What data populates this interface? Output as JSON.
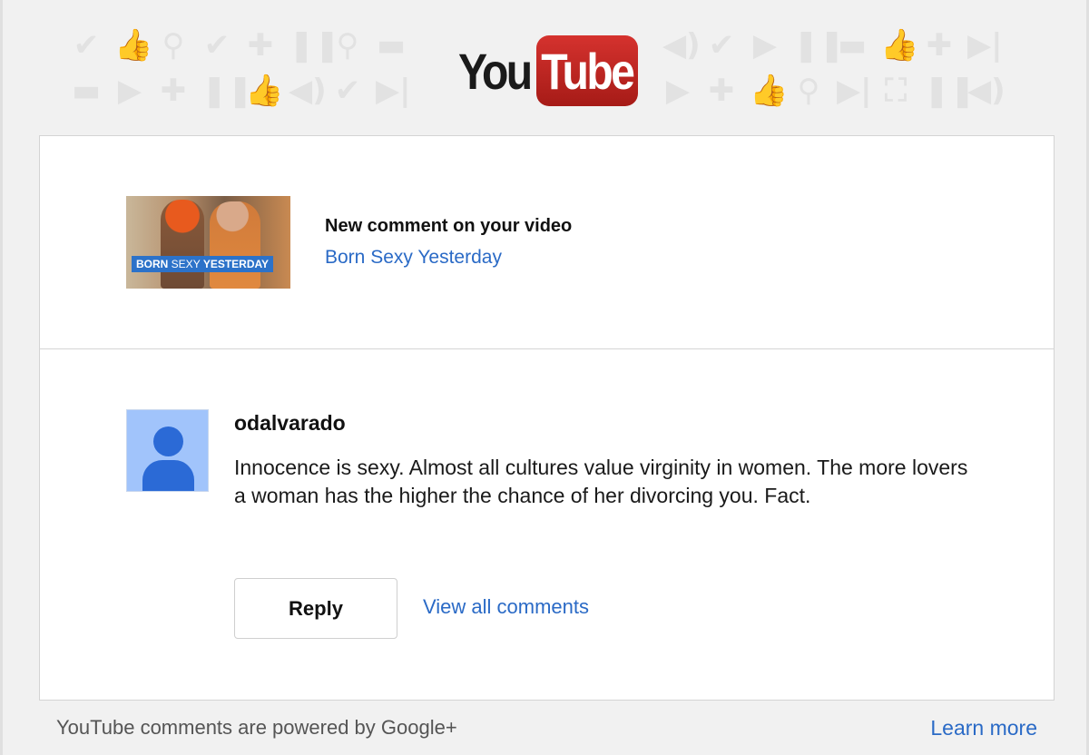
{
  "header": {
    "logo_you": "You",
    "logo_tube": "Tube",
    "pattern_icons_row1_left": [
      "check-icon",
      "thumbs-up-icon",
      "search-icon",
      "check-icon",
      "plus-icon",
      "pause-icon",
      "search-icon",
      "comment-icon"
    ],
    "pattern_icons_row2_left": [
      "comment-icon",
      "play-icon",
      "plus-icon",
      "pause-icon",
      "thumbs-up-icon",
      "volume-icon",
      "check-icon",
      "next-icon"
    ],
    "pattern_icons_row1_right": [
      "volume-icon",
      "check-icon",
      "play-icon",
      "pause-icon",
      "comment-icon",
      "thumbs-up-icon",
      "plus-icon",
      "next-icon"
    ],
    "pattern_icons_row2_right": [
      "play-icon",
      "plus-icon",
      "thumbs-up-icon",
      "search-icon",
      "next-icon",
      "fullscreen-icon",
      "pause-icon",
      "volume-icon"
    ]
  },
  "notification": {
    "thumbnail_caption_bold1": "BORN",
    "thumbnail_caption_light": " SEXY ",
    "thumbnail_caption_bold2": "YESTERDAY",
    "title": "New comment on your video",
    "video_title": "Born Sexy Yesterday"
  },
  "comment": {
    "username": "odalvarado",
    "text": "Innocence is sexy. Almost all cultures value virginity in women. The more lovers a woman has the higher the chance of her divorcing you. Fact.",
    "reply_label": "Reply",
    "view_all_label": "View all comments"
  },
  "footer": {
    "powered_text": "YouTube comments are powered by Google+",
    "learn_more_label": "Learn more"
  },
  "colors": {
    "link": "#2a6ac6",
    "logo_red": "#c4302b",
    "avatar_bg": "#a1c4fb",
    "avatar_fg": "#2b6ad6"
  }
}
